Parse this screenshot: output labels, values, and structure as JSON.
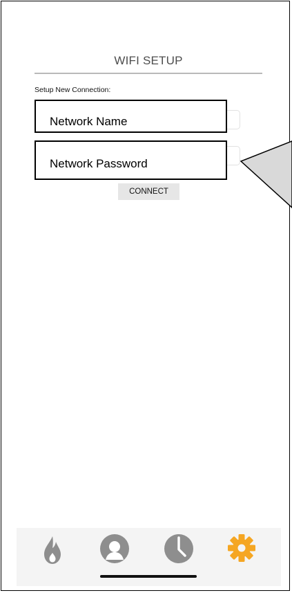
{
  "screen": {
    "title": "WIFI SETUP",
    "setup_label": "Setup New Connection:"
  },
  "form": {
    "network_name_label": "Network Name",
    "network_password_label": "Network Password",
    "connect_label": "CONNECT"
  },
  "tabbar": {
    "tabs": [
      {
        "icon": "flame-icon",
        "color": "#8e8e8e",
        "active": false
      },
      {
        "icon": "person-icon",
        "color": "#8e8e8e",
        "active": false
      },
      {
        "icon": "clock-icon",
        "color": "#8e8e8e",
        "active": false
      },
      {
        "icon": "gear-icon",
        "color": "#f5a623",
        "active": true
      }
    ]
  },
  "colors": {
    "inactive_icon": "#8e8e8e",
    "active_icon": "#f5a623",
    "tabbar_bg": "#f4f4f4",
    "callout_fill": "#d9d9d9"
  }
}
